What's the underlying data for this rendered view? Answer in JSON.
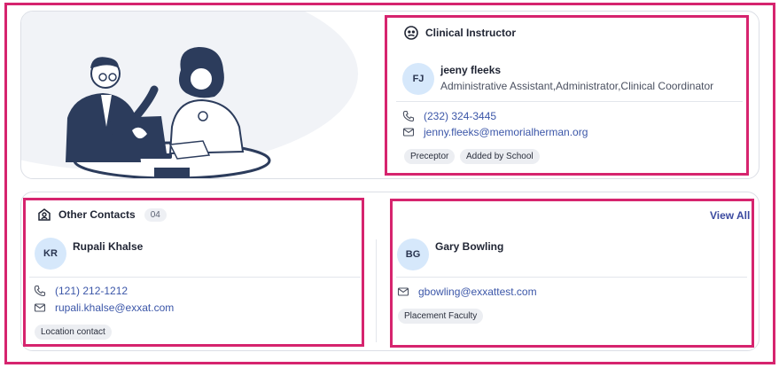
{
  "clinical_instructor": {
    "title": "Clinical Instructor",
    "person": {
      "initials": "FJ",
      "name": "jeeny fleeks",
      "roles": "Administrative Assistant,Administrator,Clinical Coordinator",
      "phone": "(232) 324-3445",
      "email": "jenny.fleeks@memorialherman.org",
      "tags": [
        "Preceptor",
        "Added by School"
      ]
    }
  },
  "other_contacts": {
    "title": "Other Contacts",
    "count": "04",
    "view_all_label": "View All",
    "contacts": [
      {
        "initials": "KR",
        "name": "Rupali Khalse",
        "phone": "(121) 212-1212",
        "email": "rupali.khalse@exxat.com",
        "tags": [
          "Location contact"
        ]
      },
      {
        "initials": "BG",
        "name": "Gary Bowling",
        "email": "gbowling@exxattest.com",
        "tags": [
          "Placement Faculty"
        ]
      }
    ]
  },
  "colors": {
    "highlight": "#d6246e",
    "link": "#3b56a8",
    "avatar_bg": "#d6e8fb",
    "tag_bg": "#eceef2"
  },
  "icons": [
    "instructor-icon",
    "contacts-icon",
    "phone-icon",
    "email-icon"
  ]
}
